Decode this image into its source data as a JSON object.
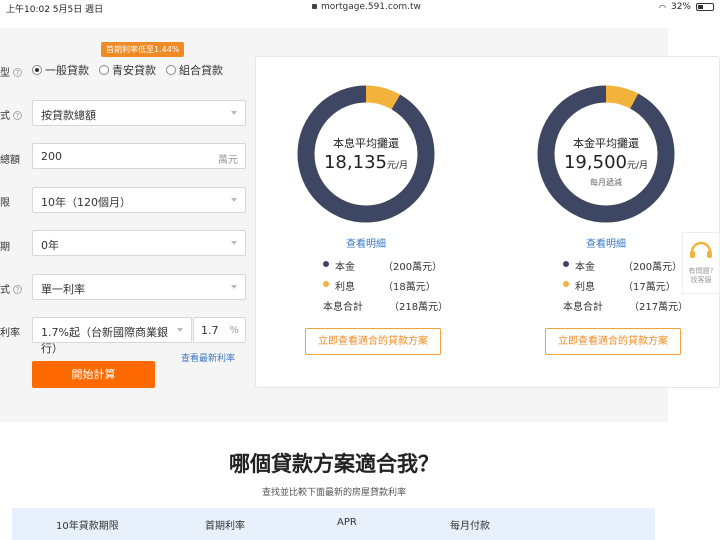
{
  "status_bar": {
    "time": "上午10:02  5月5日 週日",
    "url": "mortgage.591.com.tw",
    "battery": "32%"
  },
  "form": {
    "promo_badge": "首期利率低至1.44%",
    "rows": {
      "type_label": "型",
      "method_label": "式",
      "amount_label": "總額",
      "term_label": "限",
      "grace_label": "期",
      "rate_mode_label": "式",
      "rate_label": "利率"
    },
    "loan_types": [
      {
        "label": "一般貸款",
        "checked": true
      },
      {
        "label": "青安貸款",
        "checked": false
      },
      {
        "label": "組合貸款",
        "checked": false
      }
    ],
    "method_value": "按貸款總額",
    "amount_value": "200",
    "amount_unit": "萬元",
    "term_value": "10年（120個月）",
    "grace_value": "0年",
    "rate_mode_value": "單一利率",
    "rate_bank_value": "1.7%起（台新國際商業銀行）",
    "rate_value": "1.7",
    "rate_unit": "%",
    "latest_rate_link": "查看最新利率",
    "calc_button": "開始計算"
  },
  "results": {
    "colors": {
      "principal": "#3d4663",
      "interest": "#f2b33d"
    },
    "left": {
      "title": "本息平均攤還",
      "amount": "18,135",
      "amount_unit": "元/月",
      "sub": "",
      "principal_share": 0.917,
      "detail_link": "查看明細",
      "principal_label": "本金",
      "principal_value": "（200萬元）",
      "interest_label": "利息",
      "interest_value": "（18萬元）",
      "total_label": "本息合計",
      "total_value": "（218萬元）",
      "plan_button": "立即查看適合的貸款方案"
    },
    "right": {
      "title": "本金平均攤還",
      "amount": "19,500",
      "amount_unit": "元/月",
      "sub": "每月遞減",
      "principal_share": 0.922,
      "detail_link": "查看明細",
      "principal_label": "本金",
      "principal_value": "（200萬元）",
      "interest_label": "利息",
      "interest_value": "（17萬元）",
      "total_label": "本息合計",
      "total_value": "（217萬元）",
      "plan_button": "立即查看適合的貸款方案"
    }
  },
  "help_widget": {
    "line1": "有問題?",
    "line2": "找客服"
  },
  "section": {
    "title": "哪個貸款方案適合我？",
    "subtitle": "查找並比較下面最新的房屋貸款利率",
    "columns": [
      "10年貸款期限",
      "首期利率",
      "APR",
      "每月付款"
    ]
  }
}
